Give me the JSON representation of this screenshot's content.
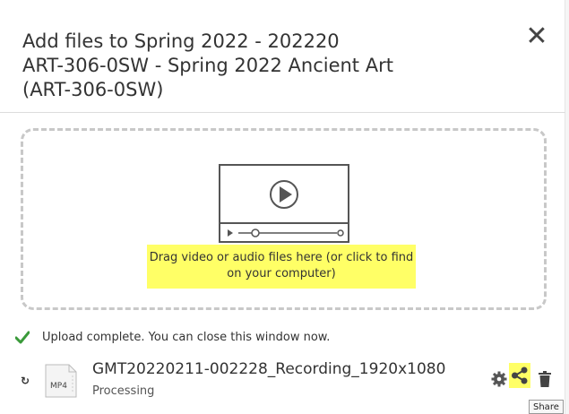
{
  "dialog": {
    "title": "Add files to Spring 2022 - 202220\nART-306-0SW - Spring 2022 Ancient Art\n(ART-306-0SW)",
    "close_symbol": "✕"
  },
  "dropzone": {
    "text": "Drag video or audio files here (or click to find on your computer)",
    "highlight_color": "#ffff66"
  },
  "upload_status": {
    "text": "Upload complete. You can close this window now.",
    "icon": "check-icon",
    "icon_color": "#3a9a3a"
  },
  "file": {
    "type_label": "MP4",
    "name": "GMT20220211-002228_Recording_1920x1080",
    "status": "Processing",
    "status_icon": "refresh-icon",
    "actions": [
      "gear-icon",
      "share-icon",
      "trash-icon"
    ]
  },
  "tooltip": {
    "text": "Share"
  }
}
